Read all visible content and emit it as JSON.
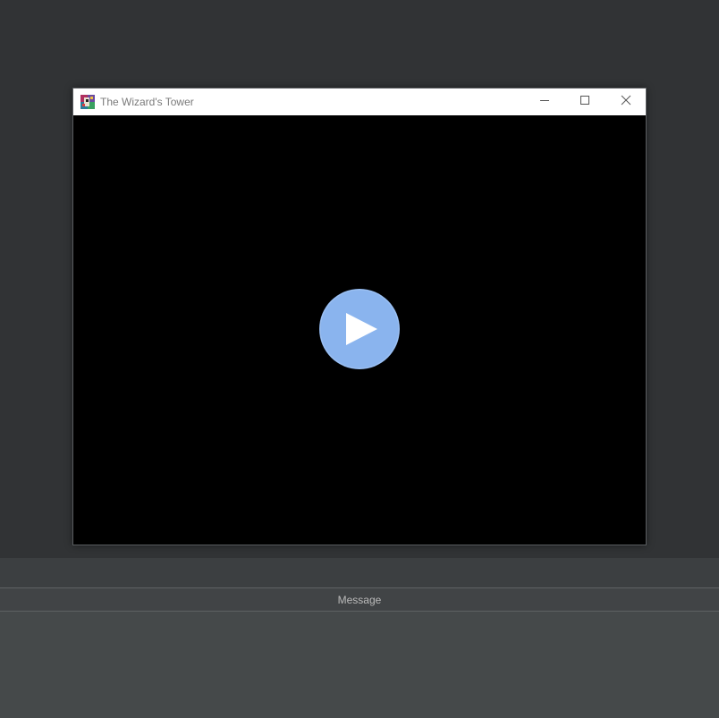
{
  "window": {
    "title": "The Wizard's Tower",
    "icon": "wizard-tower-app-icon",
    "controls": [
      "minimize-icon",
      "maximize-icon",
      "close-icon"
    ]
  },
  "game": {
    "play_icon": "play-icon",
    "play_button_color": "#8ab4ee",
    "canvas_color": "#000000"
  },
  "panel": {
    "message_header": "Message",
    "message_text": ""
  },
  "colors": {
    "workspace": "#313335",
    "panel": "#3c3f41",
    "titlebar": "#ffffff"
  }
}
